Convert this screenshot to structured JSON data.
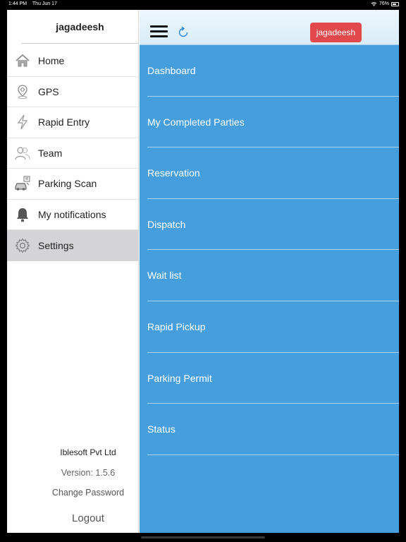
{
  "status_bar": {
    "time": "1:44 PM",
    "date": "Thu Jun 17",
    "battery": "76%",
    "battery_level": 0.76
  },
  "drawer": {
    "username": "jagadeesh",
    "items": [
      {
        "label": "Home",
        "icon": "home-icon"
      },
      {
        "label": "GPS",
        "icon": "location-pin-icon"
      },
      {
        "label": "Rapid Entry",
        "icon": "lightning-icon"
      },
      {
        "label": "Team",
        "icon": "team-icon"
      },
      {
        "label": "Parking Scan",
        "icon": "car-scan-icon"
      },
      {
        "label": "My notifications",
        "icon": "bell-icon"
      },
      {
        "label": "Settings",
        "icon": "gear-icon",
        "active": true
      }
    ],
    "company": "Iblesoft Pvt Ltd",
    "version": "Version: 1.5.6",
    "change_password": "Change Password",
    "logout": "Logout"
  },
  "topbar": {
    "user_chip": "jagadeesh",
    "icons": [
      "hamburger-menu-icon",
      "refresh-icon"
    ]
  },
  "main_menu": {
    "items": [
      "Dashboard",
      "My Completed Parties",
      "Reservation",
      "Dispatch",
      "Wait list",
      "Rapid Pickup",
      "Parking Permit",
      "Status"
    ]
  },
  "colors": {
    "primary_blue": "#479edc",
    "chip_red": "#e2494c",
    "active_row": "#d4d4d6"
  }
}
